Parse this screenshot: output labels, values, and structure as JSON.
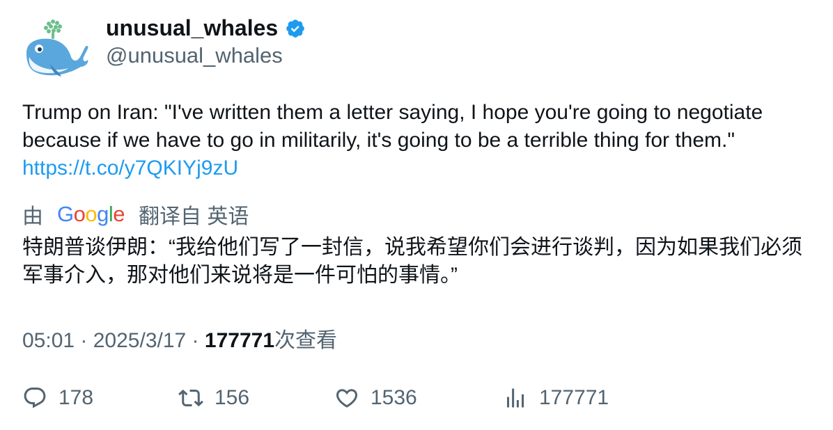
{
  "author": {
    "display_name": "unusual_whales",
    "handle": "@unusual_whales",
    "verified": true,
    "avatar_icon": "whale-logo-icon"
  },
  "tweet": {
    "text": "Trump on Iran: \"I've written them a letter saying, I hope you're going to negotiate because if we have to go in militarily, it's going to be a terrible thing for them.\" ",
    "link": "https://t.co/y7QKIYj9zU"
  },
  "translation": {
    "by_label": "由",
    "provider": "Google",
    "from_label": "翻译自 英语",
    "text": "特朗普谈伊朗：“我给他们写了一封信，说我希望你们会进行谈判，因为如果我们必须军事介入，那对他们来说将是一件可怕的事情。”"
  },
  "meta": {
    "time": "05:01",
    "sep1": " · ",
    "date": "2025/3/17",
    "sep2": " · ",
    "views_count": "177771",
    "views_label": "次查看"
  },
  "actions": {
    "replies": "178",
    "retweets": "156",
    "likes": "1536",
    "views": "177771"
  },
  "colors": {
    "link": "#1d9bf0",
    "secondary_text": "#536471",
    "primary_text": "#0f1419",
    "verified_badge": "#1d9bf0"
  }
}
